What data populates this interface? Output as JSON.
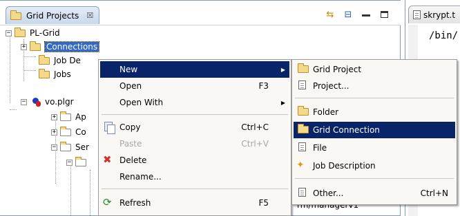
{
  "view": {
    "tab_title": "Grid Projects",
    "tab_close": "☒"
  },
  "editor": {
    "tab_title": "skrypt.t",
    "code_line": "/bin/",
    "behind_text": "rm/managerv1"
  },
  "tree": {
    "nodes": [
      {
        "label": "PL-Grid",
        "expander": "−"
      },
      {
        "label": "Connections",
        "expander": "+"
      },
      {
        "label": "Job De",
        "expander": ""
      },
      {
        "label": "Jobs",
        "expander": ""
      },
      {
        "label": "vo.plgr",
        "expander": "−"
      },
      {
        "label": "Ap",
        "expander": "+"
      },
      {
        "label": "Co",
        "expander": "+"
      },
      {
        "label": "Ser",
        "expander": "−"
      },
      {
        "label": "",
        "expander": "−"
      }
    ]
  },
  "context_menu": {
    "items": [
      {
        "label": "New",
        "accel": "",
        "submenu": "▶"
      },
      {
        "label": "Open",
        "accel": "F3",
        "submenu": ""
      },
      {
        "label": "Open With",
        "accel": "",
        "submenu": "▶"
      },
      {
        "label": "Copy",
        "accel": "Ctrl+C",
        "submenu": ""
      },
      {
        "label": "Paste",
        "accel": "Ctrl+V",
        "submenu": ""
      },
      {
        "label": "Delete",
        "accel": "",
        "submenu": ""
      },
      {
        "label": "Rename...",
        "accel": "",
        "submenu": ""
      },
      {
        "label": "Refresh",
        "accel": "F5",
        "submenu": ""
      }
    ]
  },
  "submenu": {
    "items": [
      {
        "label": "Grid Project",
        "accel": ""
      },
      {
        "label": "Project...",
        "accel": ""
      },
      {
        "label": "Folder",
        "accel": ""
      },
      {
        "label": "Grid Connection",
        "accel": ""
      },
      {
        "label": "File",
        "accel": ""
      },
      {
        "label": "Job Description",
        "accel": ""
      },
      {
        "label": "Other...",
        "accel": "Ctrl+N"
      }
    ]
  },
  "colors": {
    "menu_highlight": "#0a246a",
    "tree_selection": "#316ac5",
    "menu_background": "#f9f8f4"
  }
}
